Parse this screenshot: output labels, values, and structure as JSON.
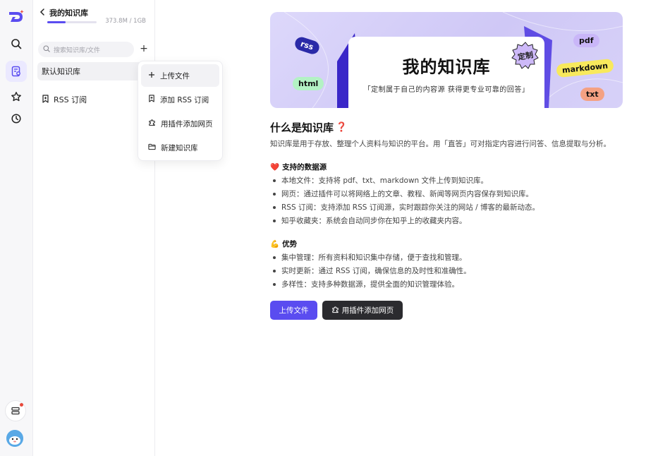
{
  "rail": {
    "icons": [
      "app-logo",
      "search-icon",
      "knowledge-base-icon",
      "star-icon",
      "history-icon",
      "layers-icon",
      "avatar"
    ]
  },
  "sidebar": {
    "title": "我的知识库",
    "quota_text": "373.8M / 1GB",
    "quota_fraction": 0.37,
    "search_placeholder": "搜索知识库/文件",
    "add_label": "+",
    "items": [
      {
        "label": "默认知识库"
      },
      {
        "label": "RSS 订阅"
      }
    ]
  },
  "menu": {
    "items": [
      {
        "label": "上传文件",
        "icon": "plus-icon"
      },
      {
        "label": "添加 RSS 订阅",
        "icon": "bookmark-plus-icon"
      },
      {
        "label": "用插件添加网页",
        "icon": "puzzle-icon"
      },
      {
        "label": "新建知识库",
        "icon": "folder-icon"
      }
    ]
  },
  "banner": {
    "title": "我的知识库",
    "subtitle": "「定制属于自己的内容源 获得更专业可靠的回答」",
    "badge": "定制",
    "tags": [
      "rss",
      "html",
      "pdf",
      "markdown",
      "txt"
    ]
  },
  "content": {
    "heading": "什么是知识库",
    "heading_emoji": "❓",
    "intro": "知识库是用于存放、整理个人资料与知识的平台。用「直答」可对指定内容进行问答、信息提取与分析。",
    "sections": [
      {
        "emoji": "❤️",
        "title": "支持的数据源",
        "items": [
          "本地文件：支持将 pdf、txt、markdown 文件上传到知识库。",
          "网页：通过插件可以将网络上的文章、教程、新闻等网页内容保存到知识库。",
          "RSS 订阅：支持添加 RSS 订阅源，实时跟踪你关注的网站 / 博客的最新动态。",
          "知乎收藏夹：系统会自动同步你在知乎上的收藏夹内容。"
        ]
      },
      {
        "emoji": "💪",
        "title": "优势",
        "items": [
          "集中管理：所有资料和知识集中存储，便于查找和管理。",
          "实时更新：通过 RSS 订阅，确保信息的及时性和准确性。",
          "多样性：支持多种数据源，提供全面的知识管理体验。"
        ]
      }
    ],
    "upload_button": "上传文件",
    "plugin_button": "用插件添加网页"
  },
  "colors": {
    "accent": "#5a4cf0",
    "dark_button": "#2b2b2f",
    "banner_bg": "#d7d1f8"
  }
}
